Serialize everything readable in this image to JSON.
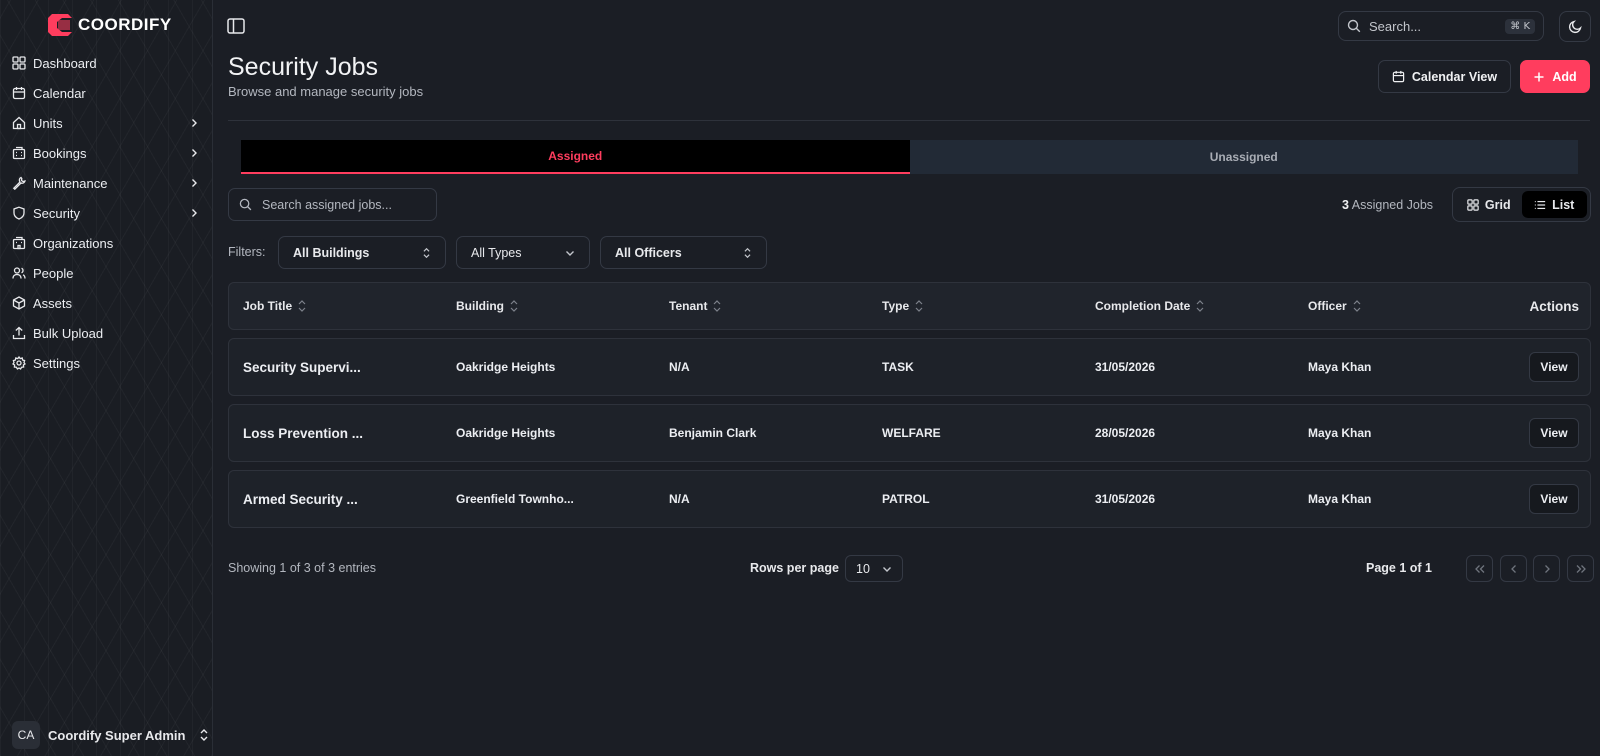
{
  "brand": {
    "name": "COORDIFY",
    "accent": "#ff3d5e"
  },
  "sidebar": {
    "items": [
      {
        "label": "Dashboard",
        "icon": "grid-icon",
        "has_children": false
      },
      {
        "label": "Calendar",
        "icon": "calendar-icon",
        "has_children": false
      },
      {
        "label": "Units",
        "icon": "home-icon",
        "has_children": true
      },
      {
        "label": "Bookings",
        "icon": "building-icon",
        "has_children": true
      },
      {
        "label": "Maintenance",
        "icon": "wrench-icon",
        "has_children": true
      },
      {
        "label": "Security",
        "icon": "shield-icon",
        "has_children": true
      },
      {
        "label": "Organizations",
        "icon": "organization-icon",
        "has_children": false
      },
      {
        "label": "People",
        "icon": "people-icon",
        "has_children": false
      },
      {
        "label": "Assets",
        "icon": "box-icon",
        "has_children": false
      },
      {
        "label": "Bulk Upload",
        "icon": "upload-icon",
        "has_children": false
      },
      {
        "label": "Settings",
        "icon": "gear-icon",
        "has_children": false
      }
    ],
    "user": {
      "initials": "CA",
      "name": "Coordify Super Admin"
    }
  },
  "topbar": {
    "search_placeholder": "Search...",
    "shortcut_symbol": "⌘",
    "shortcut_key": "K"
  },
  "header": {
    "title": "Security Jobs",
    "subtitle": "Browse and manage security jobs",
    "calendar_button": "Calendar View",
    "add_button": "Add"
  },
  "tabs": {
    "assigned": "Assigned",
    "unassigned": "Unassigned",
    "active": "Assigned"
  },
  "toolbar": {
    "search_placeholder": "Search assigned jobs...",
    "count_number": "3",
    "count_label": "Assigned Jobs",
    "grid_label": "Grid",
    "list_label": "List",
    "active_view": "List"
  },
  "filters": {
    "label": "Filters:",
    "buildings": "All Buildings",
    "types": "All Types",
    "officers": "All Officers"
  },
  "table": {
    "columns": [
      "Job Title",
      "Building",
      "Tenant",
      "Type",
      "Completion Date",
      "Officer",
      "Actions"
    ],
    "rows": [
      {
        "title": "Security Supervi...",
        "building": "Oakridge Heights",
        "tenant": "N/A",
        "type": "TASK",
        "date": "31/05/2026",
        "officer": "Maya Khan",
        "action": "View"
      },
      {
        "title": "Loss Prevention ...",
        "building": "Oakridge Heights",
        "tenant": "Benjamin Clark",
        "type": "WELFARE",
        "date": "28/05/2026",
        "officer": "Maya Khan",
        "action": "View"
      },
      {
        "title": "Armed Security ...",
        "building": "Greenfield Townho...",
        "tenant": "N/A",
        "type": "PATROL",
        "date": "31/05/2026",
        "officer": "Maya Khan",
        "action": "View"
      }
    ]
  },
  "pagination": {
    "showing": "Showing 1 of 3 of 3 entries",
    "rows_per_page_label": "Rows per page",
    "rows_per_page": "10",
    "page_info": "Page 1 of 1"
  }
}
